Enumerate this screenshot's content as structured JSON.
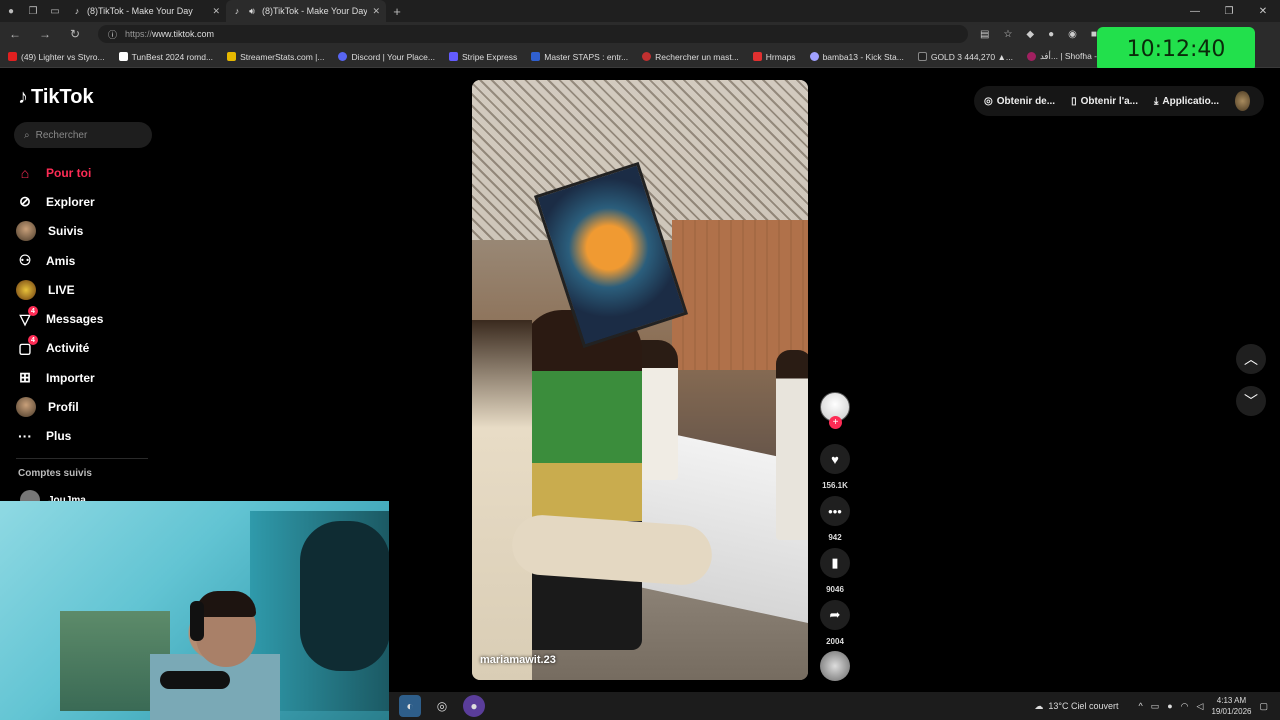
{
  "browser": {
    "tabs": [
      {
        "title": "(8)TikTok - Make Your Day",
        "active": false
      },
      {
        "title": "(8)TikTok - Make Your Day",
        "active": true
      }
    ],
    "url_proto": "https://",
    "url_host": "www.tiktok.com",
    "bookmarks": [
      "(49) Lighter vs Styro...",
      "TunBest 2024 romd...",
      "StreamerStats.com |...",
      "Discord | Your Place...",
      "Stripe Express",
      "Master STAPS : entr...",
      "Rechercher un mast...",
      "Hrmaps",
      "bamba13 - Kick Sta...",
      "GOLD 3 444,270 ▲...",
      "أفد... | Shofha - شوفها"
    ]
  },
  "overlay_clock": "10:12:40",
  "tiktok": {
    "logo": "TikTok",
    "search_placeholder": "Rechercher",
    "menu": [
      {
        "label": "Pour toi",
        "icon": "home-icon",
        "active": true,
        "badge": ""
      },
      {
        "label": "Explorer",
        "icon": "compass-icon",
        "active": false,
        "badge": ""
      },
      {
        "label": "Suivis",
        "icon": "avatar",
        "active": false,
        "badge": ""
      },
      {
        "label": "Amis",
        "icon": "friends-icon",
        "active": false,
        "badge": ""
      },
      {
        "label": "LIVE",
        "icon": "live-icon",
        "active": false,
        "badge": ""
      },
      {
        "label": "Messages",
        "icon": "send-icon",
        "active": false,
        "badge": "4"
      },
      {
        "label": "Activité",
        "icon": "activity-icon",
        "active": false,
        "badge": "4"
      },
      {
        "label": "Importer",
        "icon": "plus-square-icon",
        "active": false,
        "badge": ""
      },
      {
        "label": "Profil",
        "icon": "avatar",
        "active": false,
        "badge": ""
      },
      {
        "label": "Plus",
        "icon": "more-icon",
        "active": false,
        "badge": ""
      }
    ],
    "followed_title": "Comptes suivis",
    "followed_user": "JouJma",
    "top_actions": [
      "Obtenir de...",
      "Obtenir l'a...",
      "Applicatio..."
    ],
    "video_author": "mariamawit.23",
    "counts": {
      "likes": "156.1K",
      "comments": "942",
      "saves": "9046",
      "shares": "2004"
    }
  },
  "taskbar": {
    "weather": "13°C  Ciel couvert",
    "time": "4:13 AM",
    "date": "19/01/2026"
  }
}
